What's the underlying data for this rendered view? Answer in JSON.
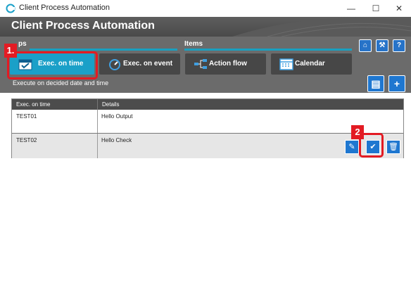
{
  "window": {
    "title": "Client Process Automation",
    "controls": {
      "minimize": "—",
      "maximize": "☐",
      "close": "✕"
    }
  },
  "header": {
    "title": "Client Process Automation"
  },
  "toolbar": {
    "section_tabs_label": "ps",
    "section_items_label": "Items",
    "tabs": [
      {
        "label": "Exec. on time",
        "icon": "calendar-check-icon",
        "active": true
      },
      {
        "label": "Exec. on event",
        "icon": "event-gauge-icon",
        "active": false
      },
      {
        "label": "Action flow",
        "icon": "flow-icon",
        "active": false
      },
      {
        "label": "Calendar",
        "icon": "calendar-icon",
        "active": false
      }
    ],
    "header_icons": [
      "home-icon",
      "tools-icon",
      "help-icon"
    ],
    "subtitle": "Execute on decided date and time",
    "right_icons": [
      "open-folder-icon",
      "add-icon"
    ]
  },
  "callouts": {
    "one": "1.",
    "two": "2"
  },
  "table": {
    "columns": [
      "Exec. on time",
      "Details"
    ],
    "rows": [
      {
        "name": "TEST01",
        "details": "Hello Output"
      },
      {
        "name": "TEST02",
        "details": "Hello Check"
      }
    ],
    "row_actions": [
      "edit-icon",
      "check-icon",
      "delete-icon"
    ]
  },
  "colors": {
    "accent": "#1aa0c8",
    "callout": "#e31b23",
    "toolbar": "#6b6b6b",
    "header": "#4a4a4a"
  }
}
